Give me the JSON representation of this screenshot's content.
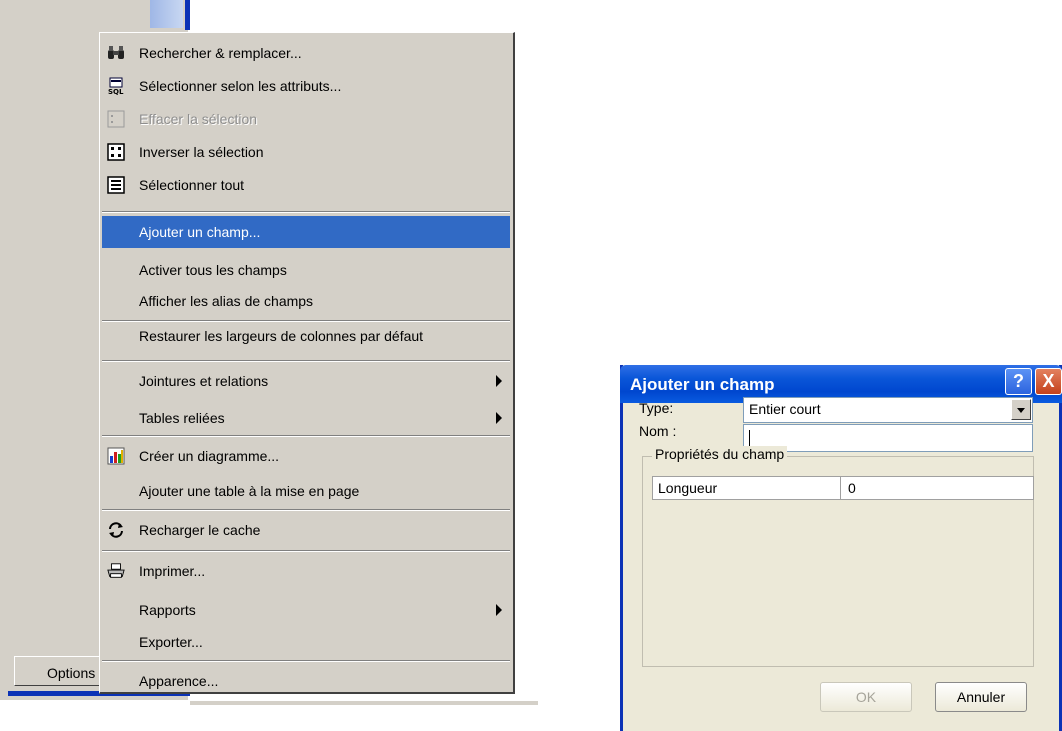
{
  "background_window": {
    "options_button": "Options"
  },
  "context_menu": {
    "items": [
      {
        "label": "Rechercher & remplacer...",
        "icon": "binoculars-icon"
      },
      {
        "label": "Sélectionner selon les attributs...",
        "icon": "sql-select-icon"
      },
      {
        "label": "Effacer la sélection",
        "icon": "clear-selection-icon",
        "disabled": true
      },
      {
        "label": "Inverser la sélection",
        "icon": "switch-selection-icon"
      },
      {
        "label": "Sélectionner tout",
        "icon": "select-all-icon"
      },
      {
        "label": "Ajouter un champ...",
        "highlighted": true
      },
      {
        "label": "Activer tous les champs"
      },
      {
        "label": "Afficher les alias de champs"
      },
      {
        "label": "Restaurer les largeurs de colonnes par défaut"
      },
      {
        "label": "Jointures et relations",
        "submenu": true
      },
      {
        "label": "Tables reliées",
        "submenu": true
      },
      {
        "label": "Créer un diagramme...",
        "icon": "chart-icon"
      },
      {
        "label": "Ajouter une table à la mise en page"
      },
      {
        "label": "Recharger le cache",
        "icon": "reload-icon"
      },
      {
        "label": "Imprimer...",
        "icon": "printer-icon"
      },
      {
        "label": "Rapports",
        "submenu": true
      },
      {
        "label": "Exporter..."
      },
      {
        "label": "Apparence..."
      }
    ]
  },
  "dialog": {
    "title": "Ajouter un champ",
    "help_button": "?",
    "close_button": "X",
    "name_label": "Nom :",
    "name_value": "",
    "type_label": "Type:",
    "type_value": "Entier court",
    "group_title": "Propriétés du champ",
    "properties": [
      {
        "name": "Longueur",
        "value": "0"
      }
    ],
    "ok_button": "OK",
    "cancel_button": "Annuler"
  },
  "colors": {
    "menu_highlight": "#316ac5",
    "titlebar_blue": "#0047cf",
    "window_bg": "#d4d0c8",
    "dialog_bg": "#ece9d8"
  }
}
